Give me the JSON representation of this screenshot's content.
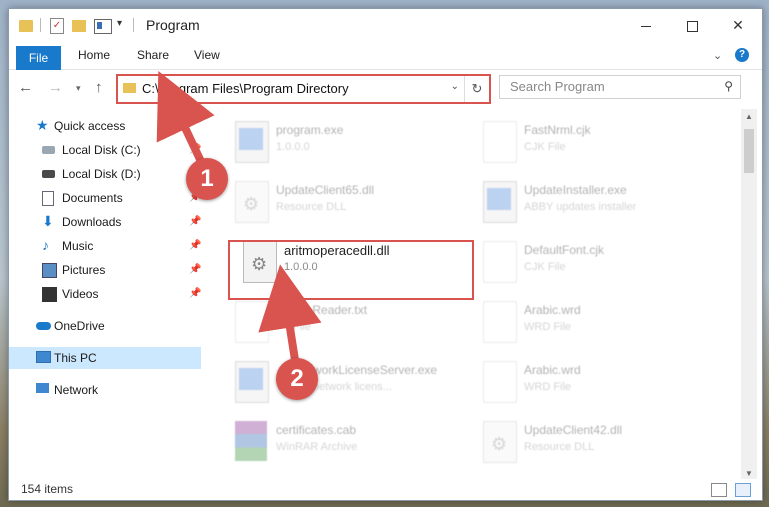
{
  "window": {
    "title": "Program"
  },
  "ribbon": {
    "file": "File",
    "home": "Home",
    "share": "Share",
    "view": "View"
  },
  "address": {
    "path": "C:\\Program Files\\Program Directory",
    "search_placeholder": "Search Program"
  },
  "sidebar": {
    "items": [
      {
        "label": "Quick access",
        "icon": "star-icon",
        "pinned": false
      },
      {
        "label": "Local Disk (C:)",
        "icon": "drive-icon",
        "pinned": true
      },
      {
        "label": "Local Disk (D:)",
        "icon": "drive-icon",
        "pinned": true
      },
      {
        "label": "Documents",
        "icon": "documents-icon",
        "pinned": true
      },
      {
        "label": "Downloads",
        "icon": "download-icon",
        "pinned": true
      },
      {
        "label": "Music",
        "icon": "music-icon",
        "pinned": true
      },
      {
        "label": "Pictures",
        "icon": "pictures-icon",
        "pinned": true
      },
      {
        "label": "Videos",
        "icon": "videos-icon",
        "pinned": true
      },
      {
        "label": "OneDrive",
        "icon": "cloud-icon",
        "pinned": false
      },
      {
        "label": "This PC",
        "icon": "computer-icon",
        "pinned": false,
        "selected": true
      },
      {
        "label": "Network",
        "icon": "network-icon",
        "pinned": false
      }
    ]
  },
  "files": [
    {
      "name": "program.exe",
      "sub": "1.0.0.0",
      "col": 0
    },
    {
      "name": "FastNrml.cjk",
      "sub": "CJK File",
      "col": 1
    },
    {
      "name": "UpdateClient65.dll",
      "sub": "Resource DLL",
      "col": 0
    },
    {
      "name": "UpdateInstaller.exe",
      "sub": "ABBY updates installer",
      "col": 1
    },
    {
      "name": "aritmoperacedll.dll",
      "sub": "1.0.0.0",
      "col": 0,
      "highlight": true
    },
    {
      "name": "DefaultFont.cjk",
      "sub": "CJK File",
      "col": 1
    },
    {
      "name": "fineReader.txt",
      "sub": "File",
      "col": 0
    },
    {
      "name": "Arabic.wrd",
      "sub": "WRD File",
      "col": 1
    },
    {
      "name": "workLicenseServer.exe",
      "sub": "network licens...",
      "col": 0
    },
    {
      "name": "Arabic.wrd",
      "sub": "WRD File",
      "col": 1
    },
    {
      "name": "certificates.cab",
      "sub": "WinRAR Archive",
      "col": 0
    },
    {
      "name": "UpdateClient42.dll",
      "sub": "Resource DLL",
      "col": 1
    }
  ],
  "status": {
    "item_count": "154 items"
  },
  "annotations": {
    "step1": "1",
    "step2": "2",
    "color": "#d9534f"
  }
}
